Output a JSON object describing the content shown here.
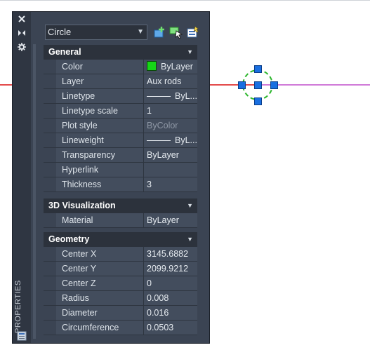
{
  "canvas": {
    "line_colors": {
      "left": "#e34a4a",
      "right": "#d07ad8"
    },
    "circle_color": "#2db62d",
    "grip_color": "#1a6fe0"
  },
  "palette": {
    "side_title": "PROPERTIES",
    "side_icons": [
      "close-icon",
      "auto-hide-icon",
      "settings-icon"
    ],
    "object_type": "Circle",
    "toolbar_icons": [
      "toggle-pickadd-icon",
      "select-objects-icon",
      "quick-select-icon"
    ],
    "sections": [
      {
        "title": "General",
        "rows": [
          {
            "name": "Color",
            "value": "ByLayer",
            "swatch": "#16d616"
          },
          {
            "name": "Layer",
            "value": "Aux rods"
          },
          {
            "name": "Linetype",
            "value": "ByL..."
          },
          {
            "name": "Linetype scale",
            "value": "1"
          },
          {
            "name": "Plot style",
            "value": "ByColor"
          },
          {
            "name": "Lineweight",
            "value": "ByL..."
          },
          {
            "name": "Transparency",
            "value": "ByLayer"
          },
          {
            "name": "Hyperlink",
            "value": ""
          },
          {
            "name": "Thickness",
            "value": "3"
          }
        ]
      },
      {
        "title": "3D Visualization",
        "rows": [
          {
            "name": "Material",
            "value": "ByLayer"
          }
        ]
      },
      {
        "title": "Geometry",
        "rows": [
          {
            "name": "Center X",
            "value": "3145.6882"
          },
          {
            "name": "Center Y",
            "value": "2099.9212"
          },
          {
            "name": "Center Z",
            "value": "0"
          },
          {
            "name": "Radius",
            "value": "0.008"
          },
          {
            "name": "Diameter",
            "value": "0.016"
          },
          {
            "name": "Circumference",
            "value": "0.0503"
          }
        ]
      }
    ]
  }
}
